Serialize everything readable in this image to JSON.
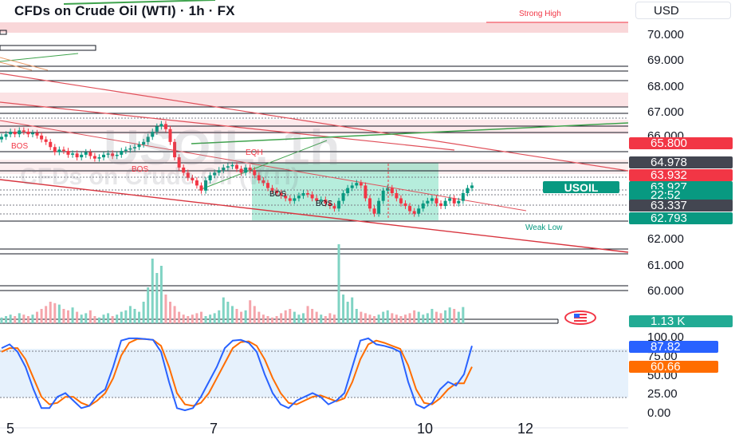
{
  "header": {
    "title": "CFDs on Crude Oil (WTI) · 1h · FX",
    "currency": "USD"
  },
  "watermark": {
    "big": "USOIL, 1h",
    "sub": "CFDs on Crude Oil (WTI)"
  },
  "price_axis": {
    "ticks": [
      "70.000",
      "69.000",
      "68.000",
      "67.000",
      "66.000",
      "62.000",
      "61.000",
      "60.000"
    ]
  },
  "badges": {
    "b1": {
      "text": "65.800",
      "color": "#f23645"
    },
    "b2": {
      "text": "64.978",
      "color": "#434651"
    },
    "b3": {
      "text": "63.932",
      "color": "#f23645"
    },
    "b4": {
      "text": "63.927",
      "color": "#089981"
    },
    "b4b": {
      "text": "22:52",
      "color": "#089981"
    },
    "b5": {
      "text": "63.337",
      "color": "#434651"
    },
    "b6": {
      "text": "62.793",
      "color": "#089981"
    }
  },
  "symbol_tag": {
    "text": "USOIL",
    "color": "#089981"
  },
  "volume": {
    "text": "1.13 K",
    "color": "#22ab94"
  },
  "oscillator": {
    "ticks": [
      "100.00",
      "75.00",
      "50.00",
      "25.00",
      "0.00"
    ],
    "k_value": {
      "text": "87.82",
      "color": "#2962ff"
    },
    "d_value": {
      "text": "60.66",
      "color": "#ff6d00"
    }
  },
  "annotations": {
    "strong_high": "Strong High",
    "weak_low": "Weak Low",
    "eqh": "EQH",
    "bos1": "BOS",
    "bos2": "BOS",
    "bos3": "BOS",
    "bos4": "BOS"
  },
  "time_axis": {
    "ticks": [
      "5",
      "7",
      "10",
      "12"
    ]
  },
  "chart_data": {
    "type": "candlestick",
    "price_range": [
      59.5,
      70.5
    ],
    "close": [
      66.0,
      66.1,
      66.2,
      66.1,
      66.25,
      66.2,
      66.1,
      66.15,
      66.05,
      65.9,
      65.8,
      65.6,
      65.4,
      65.5,
      65.45,
      65.3,
      65.35,
      65.2,
      65.3,
      65.4,
      65.25,
      65.15,
      65.2,
      65.3,
      65.35,
      65.25,
      65.3,
      65.45,
      65.5,
      65.55,
      65.6,
      65.7,
      65.8,
      66.0,
      66.2,
      66.4,
      66.5,
      66.3,
      65.8,
      65.2,
      64.8,
      64.6,
      64.4,
      64.3,
      64.1,
      63.9,
      64.3,
      64.5,
      64.6,
      64.7,
      64.8,
      64.85,
      64.9,
      64.75,
      64.6,
      64.8,
      64.7,
      64.5,
      64.3,
      64.2,
      64.0,
      63.9,
      63.8,
      63.7,
      63.6,
      63.5,
      63.6,
      63.7,
      63.8,
      63.75,
      63.6,
      63.5,
      63.55,
      63.4,
      63.3,
      63.2,
      63.5,
      63.8,
      64.0,
      64.1,
      64.2,
      64.1,
      63.6,
      63.2,
      63.0,
      63.5,
      63.9,
      64.0,
      63.8,
      63.6,
      63.4,
      63.3,
      63.1,
      63.0,
      63.2,
      63.4,
      63.5,
      63.6,
      63.4,
      63.3,
      63.5,
      63.6,
      63.4,
      63.5,
      63.8,
      64.0,
      64.1
    ],
    "volume": [
      0.4,
      0.5,
      0.6,
      0.5,
      0.7,
      0.6,
      0.5,
      0.6,
      0.8,
      1.0,
      1.2,
      1.5,
      1.4,
      1.3,
      1.0,
      0.9,
      1.1,
      0.8,
      0.6,
      0.7,
      0.9,
      0.5,
      0.4,
      0.6,
      0.7,
      0.5,
      0.6,
      0.8,
      0.9,
      1.2,
      1.0,
      0.8,
      1.5,
      2.5,
      4.5,
      3.5,
      4.0,
      2.0,
      1.5,
      1.2,
      0.8,
      0.6,
      0.5,
      0.6,
      0.7,
      0.8,
      0.5,
      0.6,
      0.7,
      0.9,
      1.8,
      1.5,
      1.2,
      1.0,
      0.8,
      0.9,
      1.6,
      1.2,
      0.8,
      0.6,
      0.5,
      0.4,
      0.5,
      0.7,
      0.9,
      1.0,
      0.8,
      0.6,
      0.7,
      1.2,
      1.0,
      0.8,
      0.6,
      0.5,
      0.7,
      0.6,
      5.5,
      2.0,
      1.5,
      1.8,
      1.0,
      0.8,
      0.7,
      0.6,
      0.5,
      0.6,
      0.8,
      0.9,
      0.7,
      0.6,
      0.5,
      0.6,
      0.7,
      0.9,
      0.8,
      0.6,
      0.7,
      1.0,
      0.8,
      0.7,
      0.9,
      1.1,
      1.0,
      0.8,
      1.13
    ],
    "stoch_k": [
      85,
      90,
      80,
      60,
      30,
      5,
      5,
      20,
      25,
      15,
      5,
      8,
      22,
      30,
      60,
      95,
      98,
      98,
      97,
      96,
      80,
      40,
      5,
      2,
      5,
      20,
      40,
      60,
      85,
      95,
      96,
      92,
      80,
      50,
      25,
      10,
      5,
      15,
      20,
      25,
      20,
      10,
      15,
      25,
      60,
      95,
      98,
      90,
      88,
      85,
      80,
      40,
      10,
      5,
      12,
      30,
      40,
      35,
      50,
      88
    ],
    "stoch_d": [
      80,
      85,
      85,
      70,
      45,
      20,
      10,
      12,
      20,
      20,
      12,
      8,
      15,
      25,
      45,
      75,
      92,
      97,
      97,
      96,
      88,
      60,
      25,
      10,
      8,
      12,
      25,
      45,
      65,
      85,
      93,
      94,
      88,
      70,
      45,
      25,
      12,
      10,
      15,
      20,
      22,
      18,
      14,
      18,
      40,
      70,
      90,
      95,
      92,
      88,
      84,
      62,
      30,
      12,
      10,
      18,
      30,
      38,
      38,
      60
    ],
    "overbought": 80,
    "oversold": 20
  }
}
